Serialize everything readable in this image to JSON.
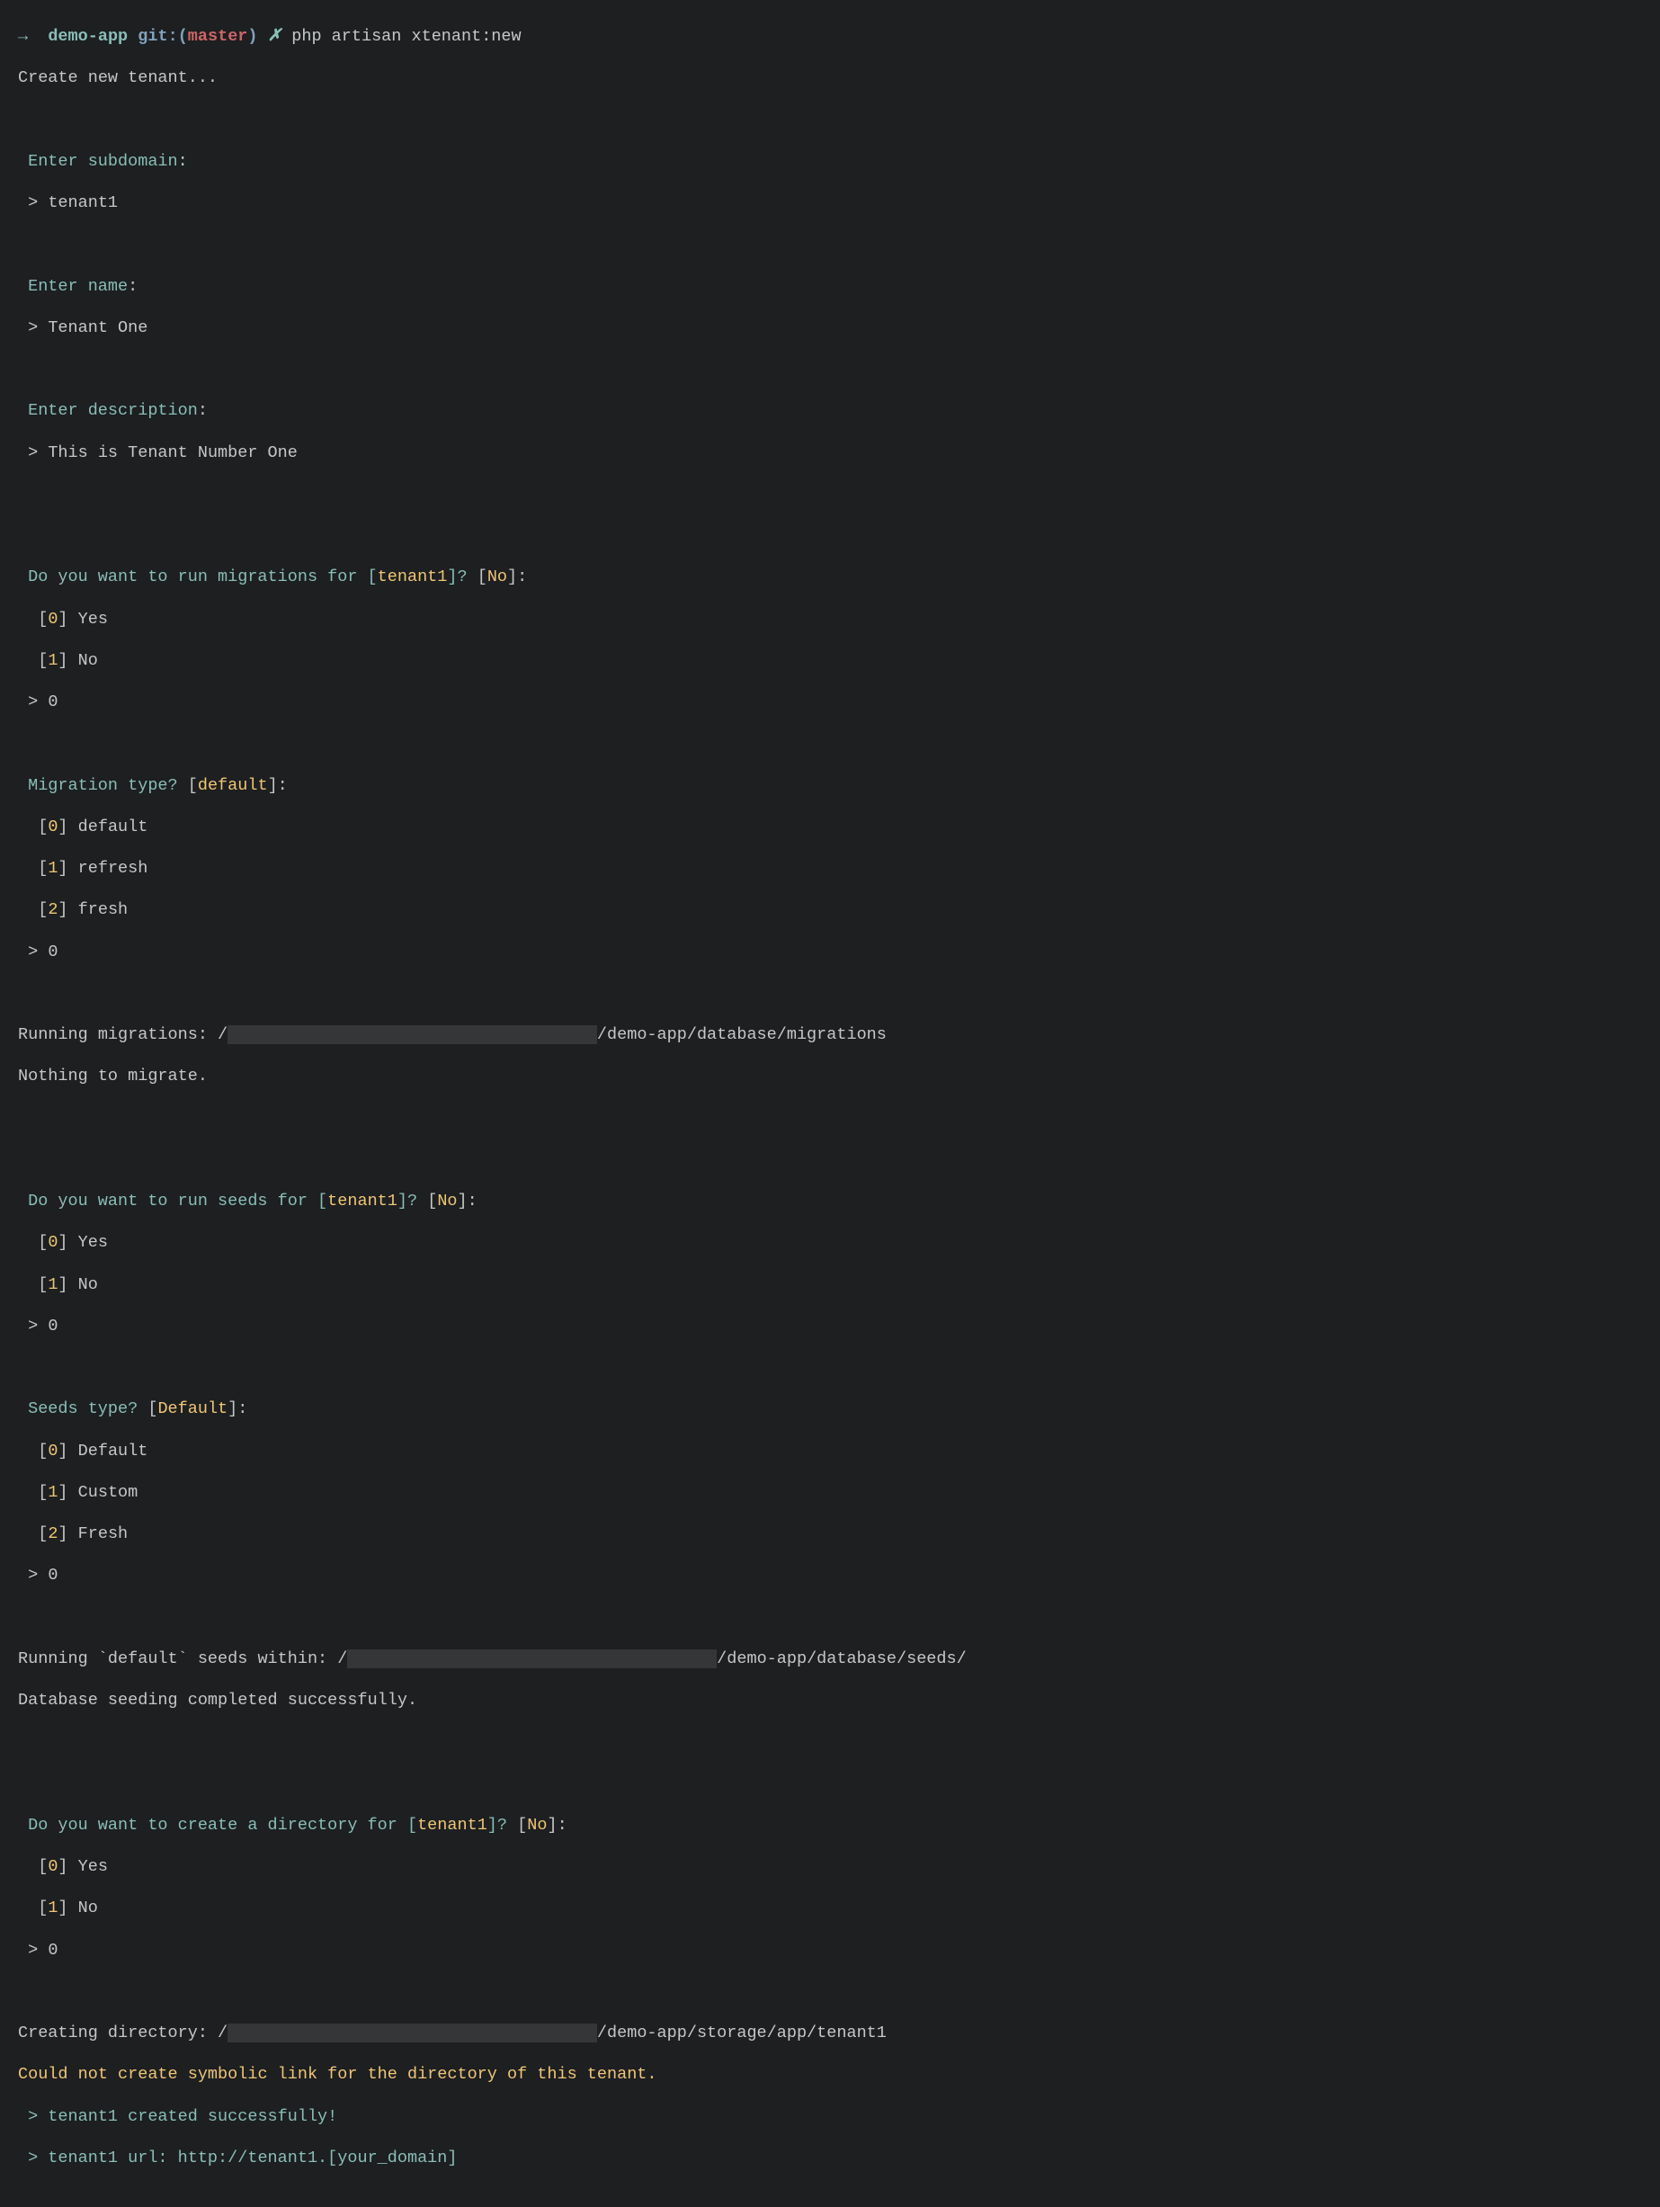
{
  "prompt": {
    "arrow": "→",
    "dir": "demo-app",
    "git": "git:",
    "paren_open": "(",
    "branch": "master",
    "paren_close": ")",
    "x": "✗",
    "command": "php artisan xtenant:new"
  },
  "intro": "Create new tenant...",
  "q1": {
    "prompt": "Enter subdomain",
    "answer": "tenant1"
  },
  "q2": {
    "prompt": "Enter name",
    "answer": "Tenant One"
  },
  "q3": {
    "prompt": "Enter description",
    "answer": "This is Tenant Number One"
  },
  "mig": {
    "question_pre": "Do you want to run migrations for [",
    "tenant": "tenant1",
    "question_post": "]?",
    "default": "No",
    "opts": [
      {
        "idx": "0",
        "label": "Yes"
      },
      {
        "idx": "1",
        "label": "No"
      }
    ],
    "answer": "0"
  },
  "migtype": {
    "question": "Migration type?",
    "default": "default",
    "opts": [
      {
        "idx": "0",
        "label": "default"
      },
      {
        "idx": "1",
        "label": "refresh"
      },
      {
        "idx": "2",
        "label": "fresh"
      }
    ],
    "answer": "0"
  },
  "migrun": {
    "prefix": "Running migrations: /",
    "redact": "                                     ",
    "suffix": "/demo-app/database/migrations",
    "nothing": "Nothing to migrate."
  },
  "seed": {
    "question_pre": "Do you want to run seeds for [",
    "tenant": "tenant1",
    "question_post": "]?",
    "default": "No",
    "opts": [
      {
        "idx": "0",
        "label": "Yes"
      },
      {
        "idx": "1",
        "label": "No"
      }
    ],
    "answer": "0"
  },
  "seedtype": {
    "question": "Seeds type?",
    "default": "Default",
    "opts": [
      {
        "idx": "0",
        "label": "Default"
      },
      {
        "idx": "1",
        "label": "Custom"
      },
      {
        "idx": "2",
        "label": "Fresh"
      }
    ],
    "answer": "0"
  },
  "seedrun": {
    "prefix": "Running `default` seeds within: /",
    "redact": "                                     ",
    "suffix": "/demo-app/database/seeds/",
    "done": "Database seeding completed successfully."
  },
  "dir": {
    "question_pre": "Do you want to create a directory for [",
    "tenant": "tenant1",
    "question_post": "]?",
    "default": "No",
    "opts": [
      {
        "idx": "0",
        "label": "Yes"
      },
      {
        "idx": "1",
        "label": "No"
      }
    ],
    "answer": "0"
  },
  "dirrun": {
    "prefix": "Creating directory: /",
    "redact": "                                     ",
    "suffix": "/demo-app/storage/app/tenant1"
  },
  "warn": "Could not create symbolic link for the directory of this tenant.",
  "done1": " > tenant1 created successfully!",
  "done2": " > tenant1 url: http://tenant1.[your_domain]",
  "chars": {
    "colon": ":",
    "gt": "> ",
    "lbrace": " [",
    "rbrace": "]",
    "lbracket": "[",
    "rbracket": "]",
    "space": " "
  }
}
